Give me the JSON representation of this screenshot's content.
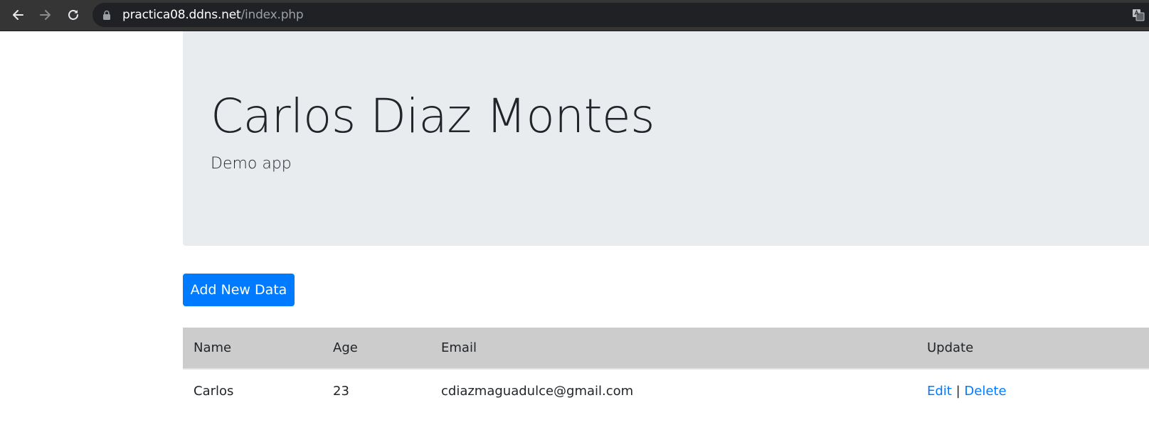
{
  "browser": {
    "url_host": "practica08.ddns.net",
    "url_path": "/index.php",
    "icons": {
      "back": "back-arrow-icon",
      "forward": "forward-arrow-icon",
      "reload": "reload-icon",
      "lock": "lock-icon",
      "translate": "translate-icon"
    }
  },
  "header": {
    "title": "Carlos Diaz Montes",
    "subtitle": "Demo app"
  },
  "actions": {
    "add_label": "Add New Data"
  },
  "table": {
    "columns": [
      "Name",
      "Age",
      "Email",
      "Update"
    ],
    "rows": [
      {
        "name": "Carlos",
        "age": "23",
        "email": "cdiazmaguadulce@gmail.com",
        "edit": "Edit",
        "separator": "|",
        "delete": "Delete"
      }
    ]
  },
  "colors": {
    "primary": "#007bff",
    "jumbotron_bg": "#e9ecef",
    "table_header_bg": "#cccccc",
    "toolbar_bg": "#353535"
  }
}
